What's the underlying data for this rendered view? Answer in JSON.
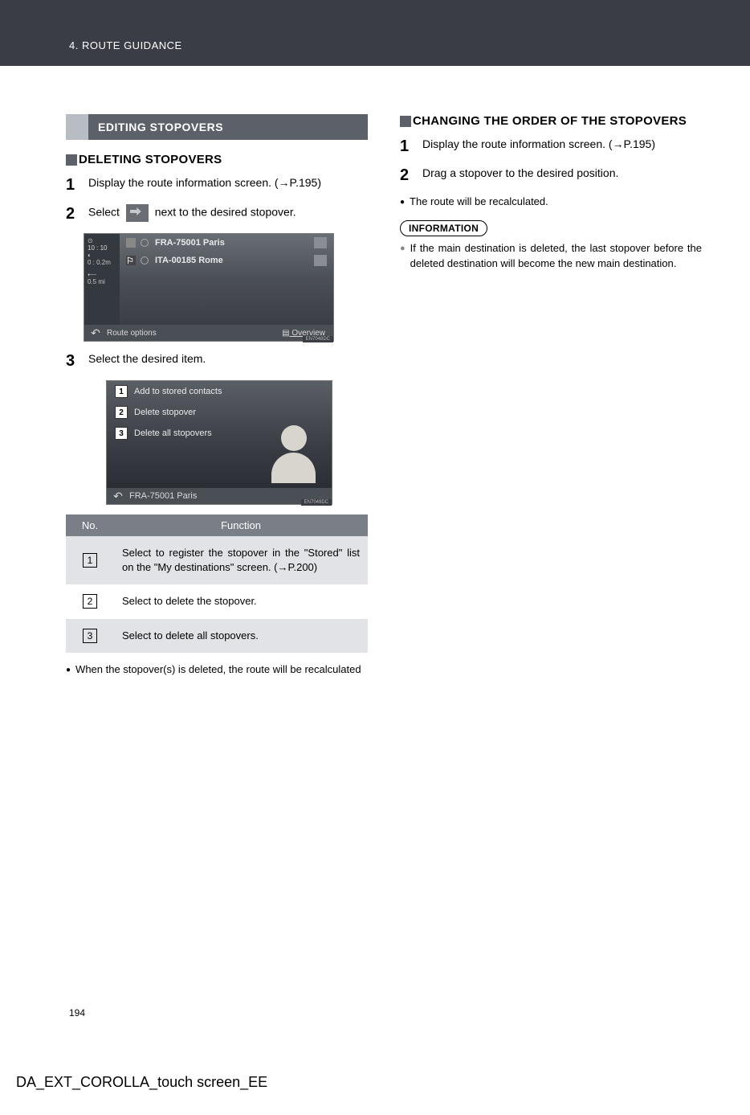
{
  "header": {
    "breadcrumb": "4. ROUTE GUIDANCE"
  },
  "left": {
    "section_title": "EDITING STOPOVERS",
    "subsection_title": "DELETING STOPOVERS",
    "step1": "Display the route information screen. (→P.195)",
    "step2_a": "Select",
    "step2_b": "next to the desired stopover.",
    "screenshot1": {
      "time": "10 : 10",
      "dist": "0 : 0.2m",
      "dist2": "0.5 mi",
      "row1": "FRA-75001 Paris",
      "row2": "ITA-00185 Rome",
      "route_options": "Route options",
      "overview": "Overview",
      "tag": "EN7048DC"
    },
    "step3": "Select the desired item.",
    "screenshot2": {
      "item1": "Add to stored contacts",
      "item2": "Delete stopover",
      "item3": "Delete all stopovers",
      "bottom": "FRA-75001 Paris",
      "tag": "EN7049DC"
    },
    "table": {
      "col1": "No.",
      "col2": "Function",
      "row1": "Select to register the stopover in the \"Stored\" list on the \"My destinations\" screen. (→P.200)",
      "row2": "Select to delete the stopover.",
      "row3": "Select to delete all stopovers."
    },
    "bullet1": "When the stopover(s) is deleted, the route will be recalculated"
  },
  "right": {
    "subsection_title": "CHANGING THE ORDER OF THE STOPOVERS",
    "step1": "Display the route information screen. (→P.195)",
    "step2": "Drag a stopover to the desired position.",
    "bullet1": "The route will be recalculated.",
    "info_label": "INFORMATION",
    "info_text": "If the main destination is deleted, the last stopover before the deleted destination will become the new main destination."
  },
  "page_number": "194",
  "footer": "DA_EXT_COROLLA_touch screen_EE"
}
